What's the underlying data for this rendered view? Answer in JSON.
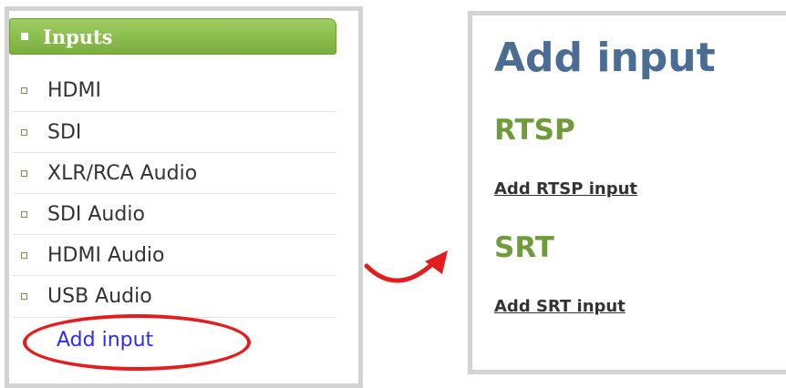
{
  "menu": {
    "header": "Inputs",
    "items": [
      {
        "label": "HDMI"
      },
      {
        "label": "SDI"
      },
      {
        "label": "XLR/RCA Audio"
      },
      {
        "label": "SDI Audio"
      },
      {
        "label": "HDMI Audio"
      },
      {
        "label": "USB Audio"
      }
    ],
    "add_input": "Add input"
  },
  "page": {
    "title": "Add input",
    "sections": [
      {
        "heading": "RTSP",
        "link": "Add RTSP input"
      },
      {
        "heading": "SRT",
        "link": "Add SRT input"
      }
    ]
  },
  "colors": {
    "header_green": "#8bbf4f",
    "heading_green": "#6f9b3b",
    "title_blue": "#4b6d94",
    "link_blue": "#2d2de6",
    "highlight_red": "#e21d1d"
  },
  "icons": {
    "arrow": "curved-arrow-right-icon"
  }
}
